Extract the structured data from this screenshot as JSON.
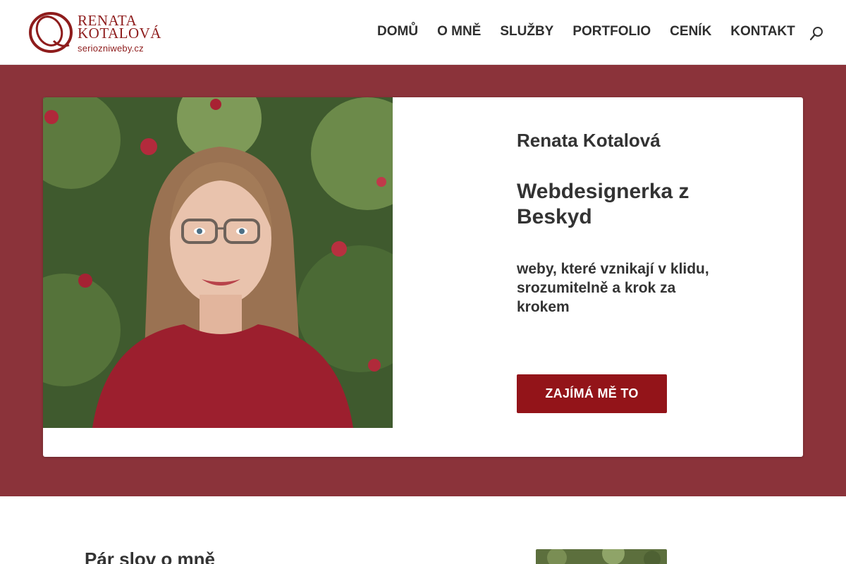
{
  "header": {
    "logo": {
      "line1": "RENATA",
      "line2": "KOTALOVÁ",
      "domain": "seriozniweby.cz",
      "brand_color": "#8e1c1c"
    },
    "nav": [
      "DOMŮ",
      "O MNĚ",
      "SLUŽBY",
      "PORTFOLIO",
      "CENÍK",
      "KONTAKT"
    ],
    "search_icon": "search-icon"
  },
  "hero": {
    "background_color": "#8b333a",
    "name": "Renata Kotalová",
    "title": "Webdesignerka z Beskyd",
    "subtitle": "weby, které vznikají v klidu, srozumitelně a krok za krokem",
    "cta_label": "ZAJÍMÁ MĚ TO",
    "cta_color": "#931419"
  },
  "about": {
    "heading": "Pár slov o mně"
  }
}
